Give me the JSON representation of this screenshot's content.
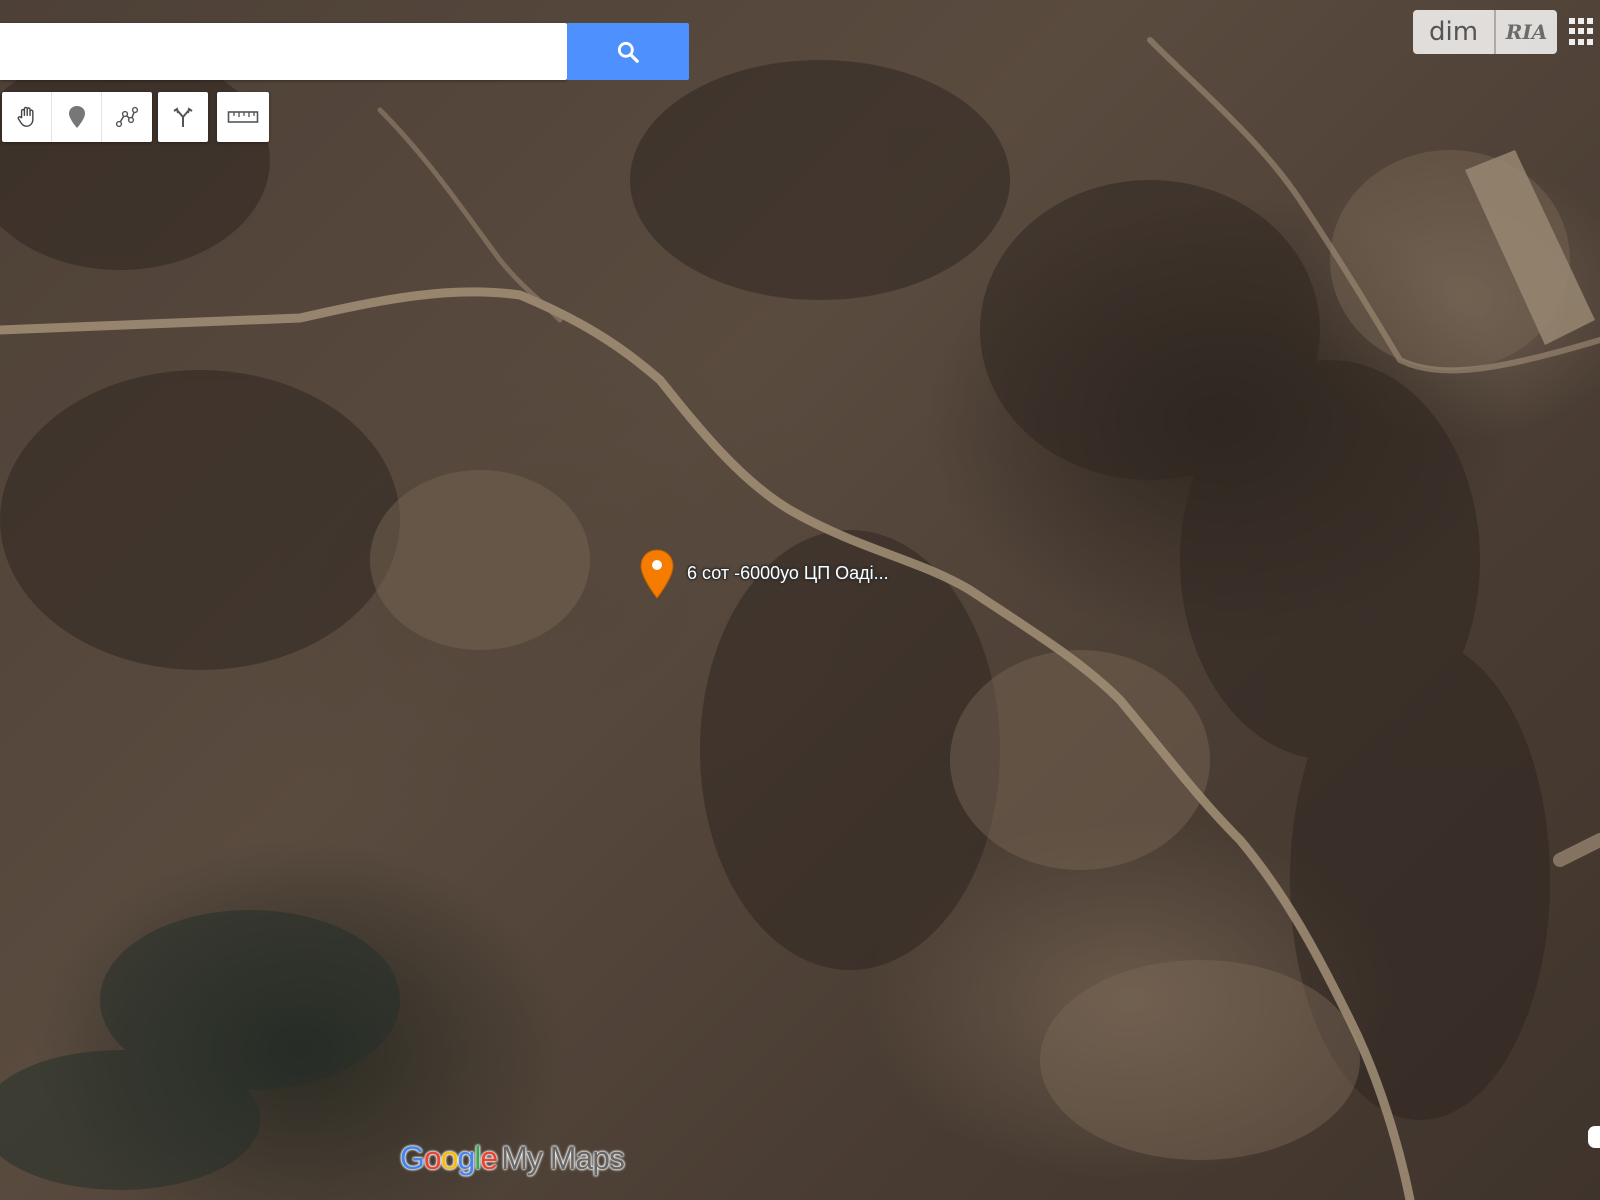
{
  "search": {
    "value": "",
    "placeholder": "",
    "button_icon": "search-icon"
  },
  "toolbar": {
    "tools": [
      {
        "name": "pan",
        "icon": "hand-icon"
      },
      {
        "name": "add-marker",
        "icon": "pin-icon"
      },
      {
        "name": "draw-line",
        "icon": "draw-line-icon"
      },
      {
        "name": "directions",
        "icon": "directions-icon"
      },
      {
        "name": "measure",
        "icon": "ruler-icon"
      }
    ]
  },
  "branding": {
    "dim": "dim",
    "ria": "RIA"
  },
  "marker": {
    "label": "6 сот -6000уо ЦП  Оаді...",
    "color": "#f57c00",
    "icon": "location-pin-icon"
  },
  "logo": {
    "google_letters": [
      "G",
      "o",
      "o",
      "g",
      "l",
      "e"
    ],
    "google_colors": [
      "#4285f4",
      "#ea4335",
      "#fbbc05",
      "#4285f4",
      "#34a853",
      "#ea4335"
    ],
    "suffix": "My Maps"
  },
  "map": {
    "type": "satellite"
  }
}
